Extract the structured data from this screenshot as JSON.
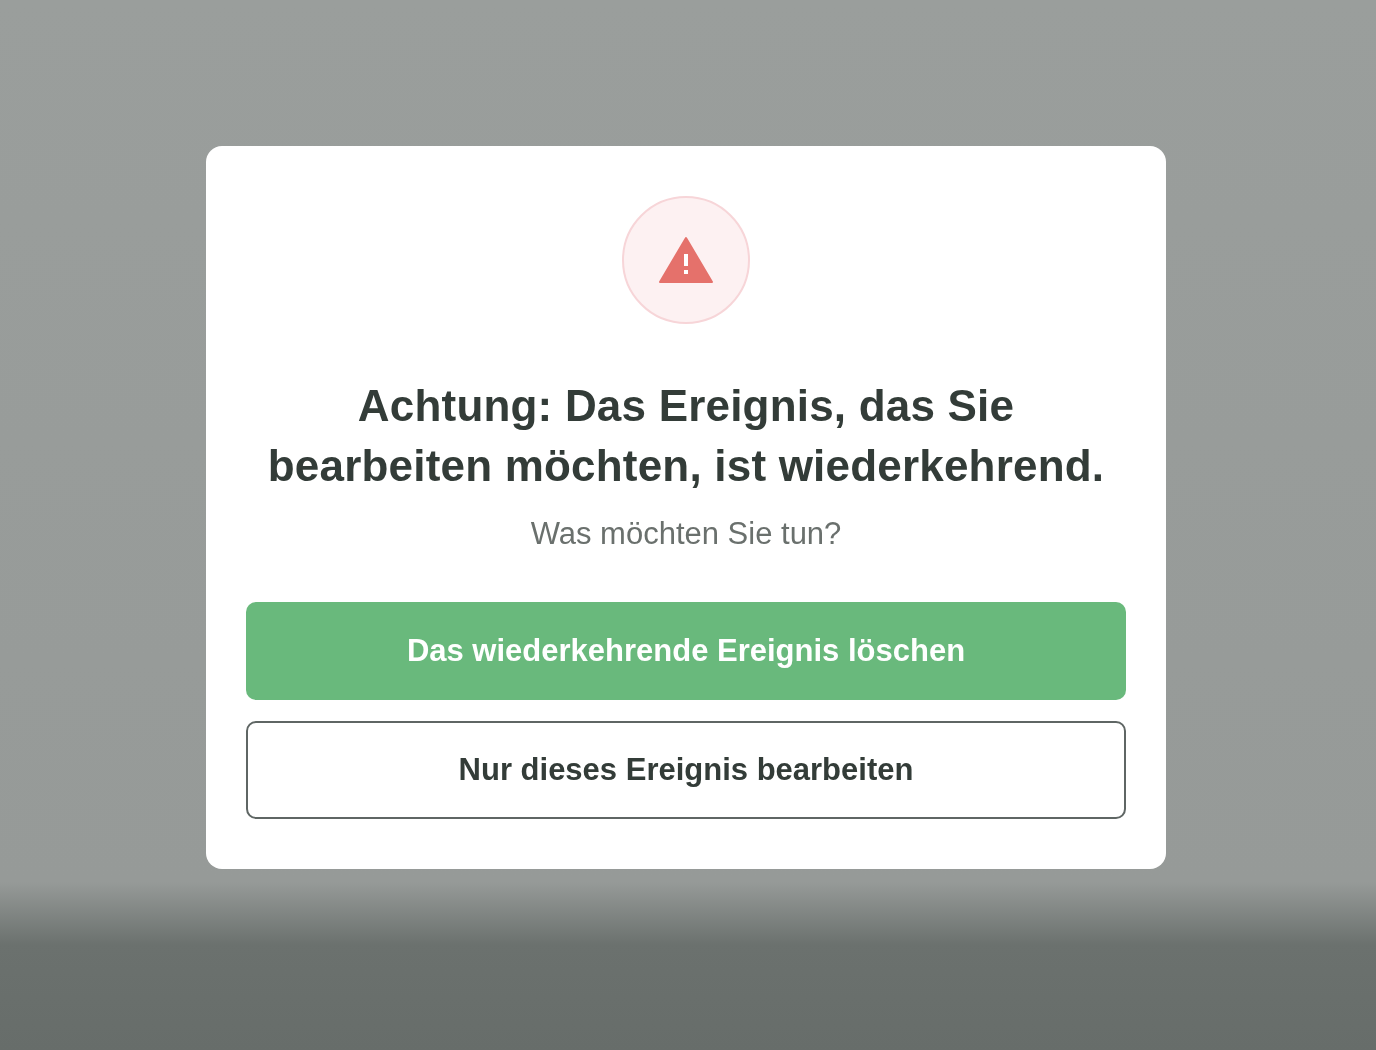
{
  "dialog": {
    "title": "Achtung: Das Ereignis, das Sie bearbeiten möchten, ist wiederkehrend.",
    "subtitle": "Was möchten Sie tun?",
    "buttons": [
      {
        "label": "Das wiederkehrende Ereignis löschen",
        "kind": "primary"
      },
      {
        "label": "Nur dieses Ereignis bearbeiten",
        "kind": "secondary"
      }
    ]
  }
}
